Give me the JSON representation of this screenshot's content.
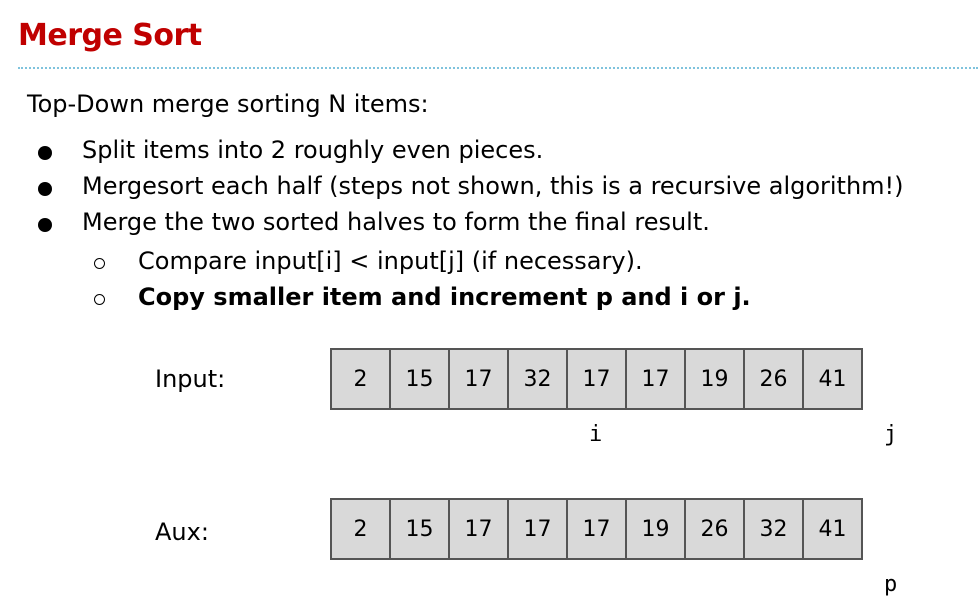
{
  "title": "Merge Sort",
  "colors": {
    "title": "#c00000",
    "rule": "#7fc3dd",
    "cell_fill": "#d9d9d9",
    "cell_border": "#555555"
  },
  "intro": "Top-Down merge sorting N items:",
  "bullets": [
    "Split items into 2 roughly even pieces.",
    "Mergesort each half (steps not shown, this is a recursive algorithm!)",
    "Merge the two sorted halves to form the final result."
  ],
  "sub_bullets": [
    "Compare input[i] < input[j] (if necessary).",
    "Copy smaller item and increment p and i or j."
  ],
  "input": {
    "label": "Input:",
    "values": [
      "2",
      "15",
      "17",
      "32",
      "17",
      "17",
      "19",
      "26",
      "41"
    ],
    "pointers": [
      {
        "name": "i",
        "index": 4
      },
      {
        "name": "j",
        "index": 9
      }
    ]
  },
  "aux": {
    "label": "Aux:",
    "values": [
      "2",
      "15",
      "17",
      "17",
      "17",
      "19",
      "26",
      "32",
      "41"
    ],
    "pointers": [
      {
        "name": "p",
        "index": 9
      }
    ]
  }
}
